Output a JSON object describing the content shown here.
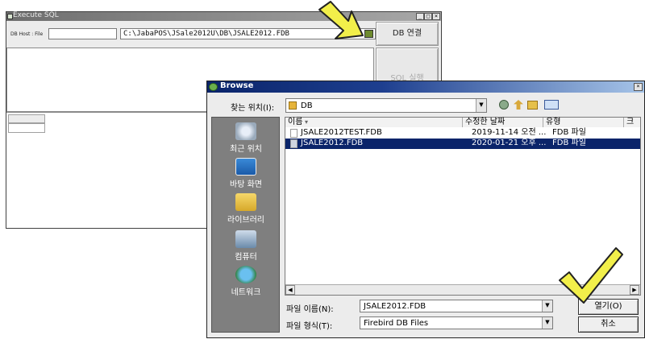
{
  "exec_window": {
    "title": "Execute SQL",
    "host_label": "DB Host : File",
    "host_value": "",
    "file_path": "C:\\JabaPOS\\JSale2012U\\DB\\JSALE2012.FDB",
    "connect_button": "DB 연결",
    "run_button": "SQL 실행",
    "minimize": "_",
    "maximize": "□",
    "close": "×"
  },
  "browse_dialog": {
    "title": "Browse",
    "close": "×",
    "look_in_label": "찾는 위치(I):",
    "look_in_value": "DB",
    "places": [
      {
        "label": "최근 위치",
        "icon": "recent-places-icon"
      },
      {
        "label": "바탕 화면",
        "icon": "desktop-icon"
      },
      {
        "label": "라이브러리",
        "icon": "libraries-icon"
      },
      {
        "label": "컴퓨터",
        "icon": "computer-icon"
      },
      {
        "label": "네트워크",
        "icon": "network-icon"
      }
    ],
    "columns": {
      "name": "이름",
      "modified": "수정한 날짜",
      "type": "유형",
      "more": "크"
    },
    "files": [
      {
        "name": "JSALE2012TEST.FDB",
        "modified": "2019-11-14 오전 ...",
        "type": "FDB 파일",
        "selected": false
      },
      {
        "name": "JSALE2012.FDB",
        "modified": "2020-01-21 오후 ...",
        "type": "FDB 파일",
        "selected": true
      }
    ],
    "filename_label": "파일 이름(N):",
    "filename_value": "JSALE2012.FDB",
    "filetype_label": "파일 형식(T):",
    "filetype_value": "Firebird DB Files",
    "open_button": "열기(O)",
    "cancel_button": "취소"
  },
  "colors": {
    "title_active": "#0a246a",
    "selection": "#0a246a",
    "places_bg": "#7f7f7f",
    "annotation_arrow": "#f2ef4a"
  }
}
